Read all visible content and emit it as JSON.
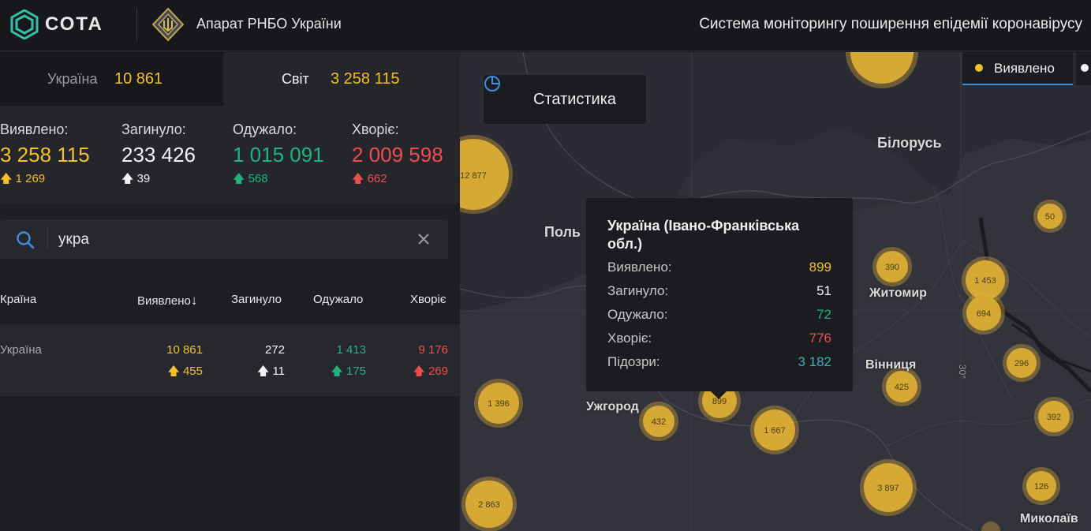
{
  "header": {
    "logo_text": "СОТА",
    "org_name": "Апарат РНБО України",
    "system_title": "Система моніторингу поширення епідемії коронавірусу"
  },
  "tabs": [
    {
      "label": "Україна",
      "value": "10 861"
    },
    {
      "label": "Світ",
      "value": "3 258 115"
    }
  ],
  "stats": [
    {
      "label": "Виявлено:",
      "value": "3 258 115",
      "delta": "1 269",
      "color": "#f2c029"
    },
    {
      "label": "Загинуло:",
      "value": "233 426",
      "delta": "39",
      "color": "#f2f2f2"
    },
    {
      "label": "Одужало:",
      "value": "1 015 091",
      "delta": "568",
      "color": "#21b37c"
    },
    {
      "label": "Хворіє:",
      "value": "2 009 598",
      "delta": "662",
      "color": "#ef4d4d"
    }
  ],
  "search": {
    "value": "укра"
  },
  "table": {
    "headers": [
      "Країна",
      "Виявлено",
      "Загинуло",
      "Одужало",
      "Хворіє"
    ],
    "rows": [
      {
        "country": "Україна",
        "confirmed": "10 861",
        "confirmed_delta": "455",
        "deaths": "272",
        "deaths_delta": "11",
        "recovered": "1 413",
        "recovered_delta": "175",
        "sick": "9 176",
        "sick_delta": "269"
      }
    ]
  },
  "map": {
    "stat_button": "Статистика",
    "legend_label": "Виявлено",
    "labels": {
      "belarus": "Білорусь",
      "poland": "Поль",
      "zhytomyr": "Житомир",
      "vinnytsia": "Вінниця",
      "uzhhorod": "Ужгород",
      "mykolaiv": "Миколаїв",
      "meridian": "30°"
    },
    "clusters": [
      "12 877",
      "50",
      "390",
      "1 453",
      "694",
      "296",
      "425",
      "392",
      "1 396",
      "432",
      "899",
      "1 667",
      "3 897",
      "126",
      "2 863"
    ],
    "tooltip": {
      "title": "Україна (Івано-Франківська обл.)",
      "rows": [
        {
          "label": "Виявлено:",
          "value": "899"
        },
        {
          "label": "Загинуло:",
          "value": "51"
        },
        {
          "label": "Одужало:",
          "value": "72"
        },
        {
          "label": "Хворіє:",
          "value": "776"
        },
        {
          "label": "Підозри:",
          "value": "3 182"
        }
      ]
    }
  }
}
